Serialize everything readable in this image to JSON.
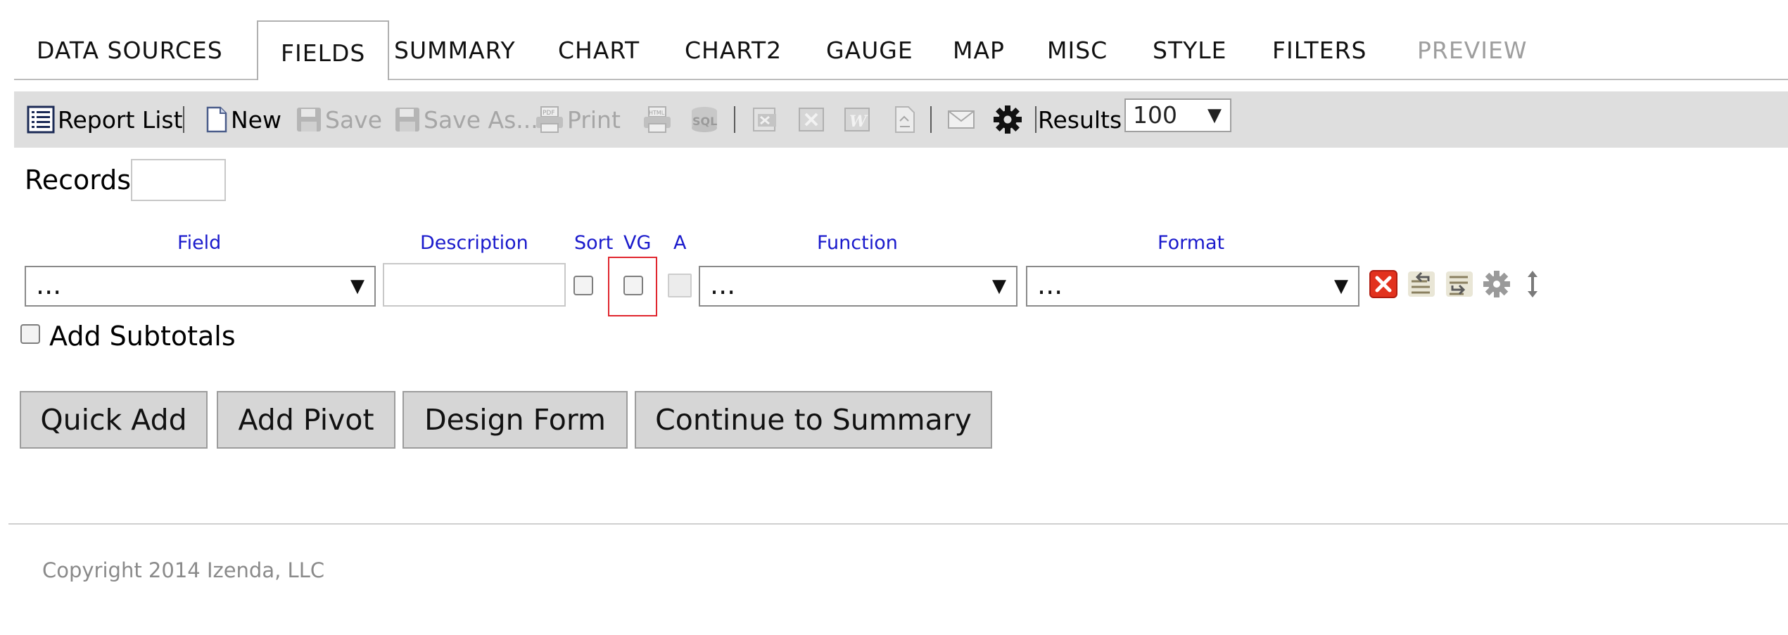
{
  "tabs": [
    {
      "label": "DATA SOURCES"
    },
    {
      "label": "FIELDS"
    },
    {
      "label": "SUMMARY"
    },
    {
      "label": "CHART"
    },
    {
      "label": "CHART2"
    },
    {
      "label": "GAUGE"
    },
    {
      "label": "MAP"
    },
    {
      "label": "MISC"
    },
    {
      "label": "STYLE"
    },
    {
      "label": "FILTERS"
    },
    {
      "label": "PREVIEW"
    }
  ],
  "toolbar": {
    "report_list": "Report List",
    "new": "New",
    "save": "Save",
    "save_as": "Save As...",
    "print": "Print",
    "results_label": "Results",
    "results_value": "100"
  },
  "records": {
    "label": "Records",
    "value": ""
  },
  "columns": {
    "field": "Field",
    "description": "Description",
    "sort": "Sort",
    "vg": "VG",
    "a": "A",
    "function": "Function",
    "format": "Format"
  },
  "field_row": {
    "field_value": "...",
    "description_value": "",
    "function_value": "...",
    "format_value": "..."
  },
  "subtotals": {
    "label": "Add Subtotals"
  },
  "buttons": {
    "quick_add": "Quick Add",
    "add_pivot": "Add Pivot",
    "design_form": "Design Form",
    "continue": "Continue to Summary"
  },
  "footer": {
    "copyright": "Copyright 2014 Izenda, LLC"
  },
  "colors": {
    "header_link": "#1a1acc",
    "highlight": "#e0262e",
    "toolbar_bg": "#dedede"
  }
}
